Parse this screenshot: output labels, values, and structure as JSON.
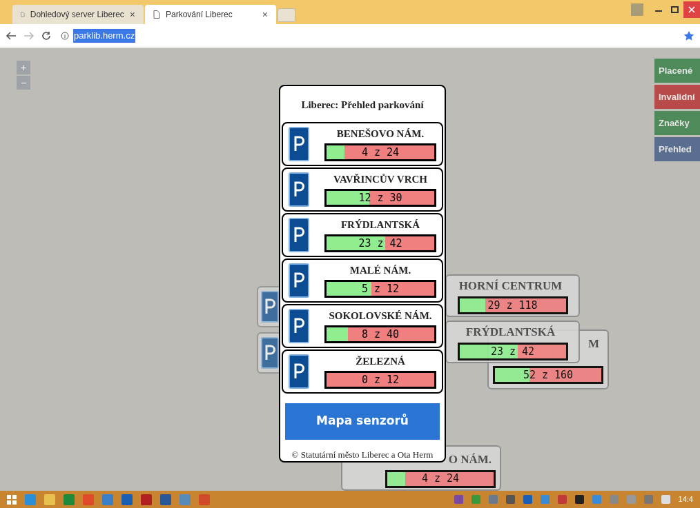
{
  "browser": {
    "tabs": [
      {
        "title": "Dohledový server Liberec",
        "close": "×",
        "selected": false
      },
      {
        "title": "Parkování Liberec",
        "close": "×",
        "selected": true
      }
    ],
    "url": "parklib.herm.cz"
  },
  "map": {
    "zoom_in": "+",
    "zoom_out": "−",
    "layers": [
      {
        "label": "Placené",
        "color": "#4e8a5a"
      },
      {
        "label": "Invalidní",
        "color": "#b84a4a"
      },
      {
        "label": "Značky",
        "color": "#4e8a5a"
      },
      {
        "label": "Přehled",
        "color": "#5a6f8f"
      }
    ],
    "background_signs": [
      {
        "title": "HORNÍ CENTRUM",
        "reading": "29 z 118",
        "level": 0.246
      },
      {
        "title": "FRÝDLANTSKÁ",
        "reading": "23 z 42",
        "level": 0.548
      },
      {
        "title": "M",
        "reading": "52 z 160",
        "level": 0.325
      },
      {
        "title": "O NÁM.",
        "reading": "4 z 24",
        "level": 0.167
      }
    ]
  },
  "panel": {
    "title": "Liberec: Přehled parkování",
    "lots": [
      {
        "name": "BENEŠOVO NÁM.",
        "reading": "4 z 24",
        "level": 0.167
      },
      {
        "name": "VAVŘINCŮV VRCH",
        "reading": "12 z 30",
        "level": 0.4
      },
      {
        "name": "FRÝDLANTSKÁ",
        "reading": "23 z 42",
        "level": 0.548
      },
      {
        "name": "MALÉ NÁM.",
        "reading": "5 z 12",
        "level": 0.417
      },
      {
        "name": "SOKOLOVSKÉ NÁM.",
        "reading": "8 z 40",
        "level": 0.2
      },
      {
        "name": "ŽELEZNÁ",
        "reading": "0 z 12",
        "level": 0
      }
    ],
    "button": "Mapa senzorů",
    "footer": "© Statutární město Liberec a Ota Herm"
  },
  "taskbar": {
    "clock": "14:4"
  }
}
